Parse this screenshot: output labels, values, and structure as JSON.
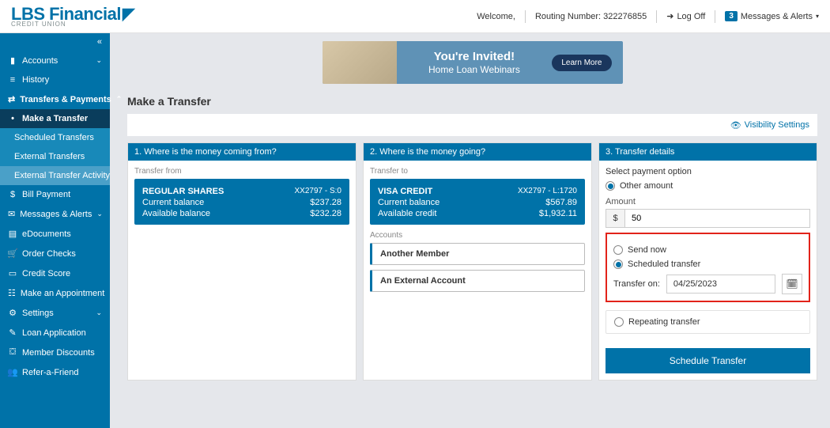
{
  "brand": {
    "name": "LBS Financial",
    "sub": "CREDIT UNION"
  },
  "top": {
    "welcome": "Welcome,",
    "routing_label": "Routing Number:",
    "routing": "322276855",
    "logoff": "Log Off",
    "alerts_count": "3",
    "alerts_label": "Messages & Alerts"
  },
  "promo": {
    "t1": "You're Invited!",
    "t2": "Home Loan Webinars",
    "btn": "Learn More"
  },
  "page_title": "Make a Transfer",
  "visibility": "Visibility Settings",
  "nav": {
    "accounts": "Accounts",
    "history": "History",
    "transfers": "Transfers & Payments",
    "make": "Make a Transfer",
    "scheduled": "Scheduled Transfers",
    "external": "External Transfers",
    "ext_activity": "External Transfer Activity",
    "bill": "Bill Payment",
    "msgs": "Messages & Alerts",
    "edocs": "eDocuments",
    "order": "Order Checks",
    "score": "Credit Score",
    "appoint": "Make an Appointment",
    "settings": "Settings",
    "loan": "Loan Application",
    "discounts": "Member Discounts",
    "refer": "Refer-a-Friend"
  },
  "col1": {
    "header": "1. Where is the money coming from?",
    "from_lbl": "Transfer from",
    "acct_name": "REGULAR SHARES",
    "acct_id": "XX2797 - S:0",
    "cb_lbl": "Current balance",
    "cb_val": "$237.28",
    "ab_lbl": "Available balance",
    "ab_val": "$232.28"
  },
  "col2": {
    "header": "2. Where is the money going?",
    "to_lbl": "Transfer to",
    "acct_name": "VISA CREDIT",
    "acct_id": "XX2797 - L:1720",
    "cb_lbl": "Current balance",
    "cb_val": "$567.89",
    "ac_lbl": "Available credit",
    "ac_val": "$1,932.11",
    "accts_lbl": "Accounts",
    "opt1": "Another Member",
    "opt2": "An External Account"
  },
  "col3": {
    "header": "3. Transfer details",
    "pay_opt": "Select payment option",
    "other_amt": "Other amount",
    "amount_lbl": "Amount",
    "amount_val": "50",
    "send_now": "Send now",
    "sched": "Scheduled transfer",
    "transfer_on": "Transfer on:",
    "date": "04/25/2023",
    "repeat": "Repeating transfer",
    "btn": "Schedule Transfer"
  }
}
